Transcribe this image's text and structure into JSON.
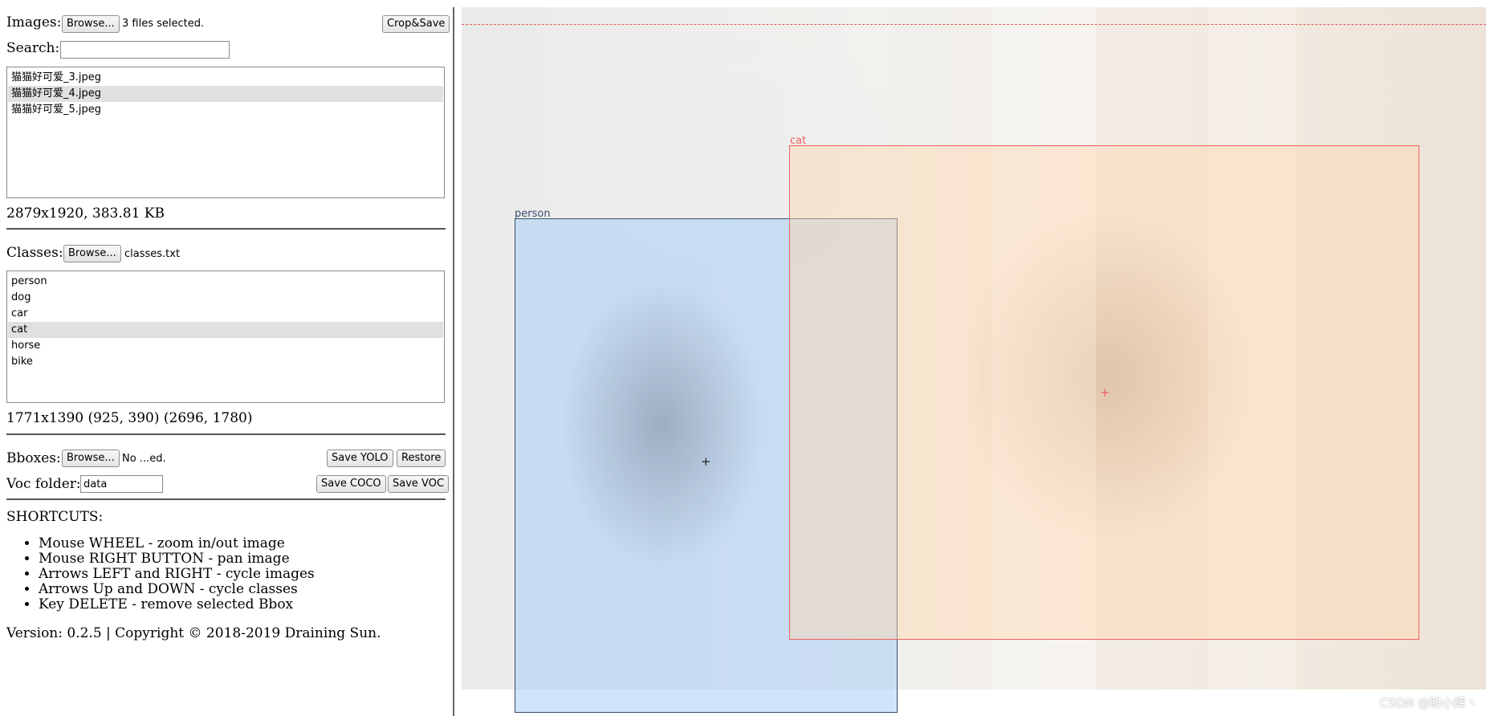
{
  "images": {
    "label": "Images:",
    "browse_label": "Browse...",
    "status": "3 files selected.",
    "crop_save_label": "Crop&Save"
  },
  "search": {
    "label": "Search:",
    "value": ""
  },
  "file_list": [
    {
      "name": "猫猫好可爱_3.jpeg",
      "selected": false
    },
    {
      "name": "猫猫好可爱_4.jpeg",
      "selected": true
    },
    {
      "name": "猫猫好可爱_5.jpeg",
      "selected": false
    }
  ],
  "image_info": "2879x1920, 383.81 KB",
  "classes": {
    "label": "Classes:",
    "browse_label": "Browse...",
    "file": "classes.txt"
  },
  "class_list": [
    {
      "name": "person",
      "selected": false
    },
    {
      "name": "dog",
      "selected": false
    },
    {
      "name": "car",
      "selected": false
    },
    {
      "name": "cat",
      "selected": true
    },
    {
      "name": "horse",
      "selected": false
    },
    {
      "name": "bike",
      "selected": false
    }
  ],
  "bbox_info": "1771x1390 (925, 390) (2696, 1780)",
  "bboxes": {
    "label": "Bboxes:",
    "browse_label": "Browse...",
    "status": "No ...ed.",
    "save_yolo_label": "Save YOLO",
    "restore_label": "Restore"
  },
  "voc": {
    "label": "Voc folder:",
    "value": "data",
    "save_coco_label": "Save COCO",
    "save_voc_label": "Save VOC"
  },
  "shortcuts": {
    "title": "SHORTCUTS:",
    "items": [
      "Mouse WHEEL - zoom in/out image",
      "Mouse RIGHT BUTTON - pan image",
      "Arrows LEFT and RIGHT - cycle images",
      "Arrows Up and DOWN - cycle classes",
      "Key DELETE - remove selected Bbox"
    ]
  },
  "version": "Version: 0.2.5 | Copyright © 2018-2019 Draining Sun.",
  "annotations": [
    {
      "label": "person",
      "color": "#3a4f6b"
    },
    {
      "label": "cat",
      "color": "#f06060"
    }
  ],
  "watermark": "CSDN @盼小辉丶",
  "colors": {
    "person_box": "#3a4f6b",
    "cat_box": "#f06060",
    "guide_line": "#e05a5a"
  }
}
